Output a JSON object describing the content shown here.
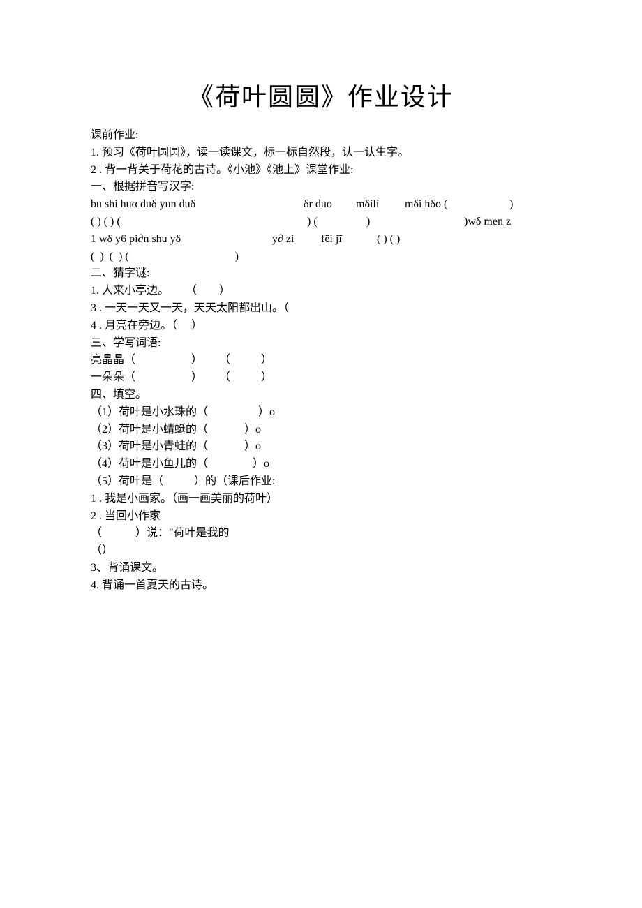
{
  "title": "《荷叶圆圆》作业设计",
  "pre_class": {
    "heading": "课前作业:",
    "item1": "1. 预习《荷叶圆圆》，读一读课文，标一标自然段，认一认生字。",
    "item2": "2 . 背一背关于荷花的古诗。《小池》《池上》课堂作业:"
  },
  "section1": {
    "heading": "一、根据拼音写汉字:",
    "row1": {
      "c1": "bu shi huα duδ yun duδ",
      "c2": "δr duo",
      "c3": "mδilì",
      "c4": "mδi hδo (",
      "c5": ")"
    },
    "row2": {
      "left": "(  ) (  ) (",
      "mid1": ") (",
      "mid2": ")",
      "right": ")wδ men z"
    },
    "row3": {
      "c1": "1 wδ y6 pi∂n shu yδ",
      "c2": "y∂ zi",
      "c3": "fēi jī",
      "c4": "(  ) (  )"
    },
    "row4": "(  )  (  ) (                                      )"
  },
  "section2": {
    "heading": "二、猜字谜:",
    "item1": "1. 人来小亭边。      （        ）",
    "item2": "3 . 一天一天又一天，天天太阳都出山。（",
    "item3": "4 . 月亮在旁边。（     ）"
  },
  "section3": {
    "heading": "三、学写词语:",
    "item1": "亮晶晶（                    ）      （           ）",
    "item2": "一朵朵（                    ）      （           ）"
  },
  "section4": {
    "heading": "四、填空。",
    "item1": "（1）荷叶是小水珠的（                  ）o",
    "item2": "（2）荷叶是小蜻蜓的（             ）o",
    "item3": "（3）荷叶是小青蛙的（             ）o",
    "item4": "（4）荷叶是小鱼儿的（                ）o",
    "item5": "（5）荷叶是（           ）的（课后作业:"
  },
  "post": {
    "item1": "1 . 我是小画家。（画一画美丽的荷叶）",
    "item2": "2 . 当回小作家",
    "item3": "（            ）说：\"荷叶是我的",
    "item4": "（）",
    "item5": "3、背诵课文。",
    "item6": "4. 背诵一首夏天的古诗。"
  }
}
